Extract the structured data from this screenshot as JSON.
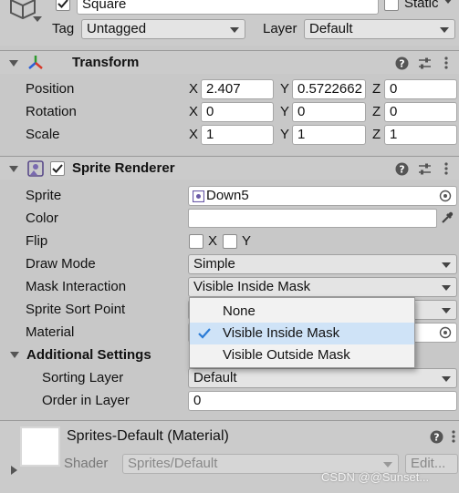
{
  "object": {
    "name": "Square",
    "active": true,
    "static_label": "Static",
    "static": false,
    "tag_label": "Tag",
    "tag_value": "Untagged",
    "layer_label": "Layer",
    "layer_value": "Default"
  },
  "transform": {
    "title": "Transform",
    "rows": [
      {
        "label": "Position",
        "x": "2.407",
        "y": "0.5722662",
        "z": "0"
      },
      {
        "label": "Rotation",
        "x": "0",
        "y": "0",
        "z": "0"
      },
      {
        "label": "Scale",
        "x": "1",
        "y": "1",
        "z": "1"
      }
    ],
    "axis_x": "X",
    "axis_y": "Y",
    "axis_z": "Z"
  },
  "sprite_renderer": {
    "title": "Sprite Renderer",
    "enabled": true,
    "sprite_label": "Sprite",
    "sprite_value": "Down5",
    "color_label": "Color",
    "color_value": "#ffffff",
    "flip_label": "Flip",
    "flip_x": "X",
    "flip_y": "Y",
    "draw_mode_label": "Draw Mode",
    "draw_mode_value": "Simple",
    "mask_label": "Mask Interaction",
    "mask_value": "Visible Inside Mask",
    "sort_point_label": "Sprite Sort Point",
    "material_label": "Material",
    "additional_settings": "Additional Settings",
    "sorting_layer_label": "Sorting Layer",
    "sorting_layer_value": "Default",
    "order_label": "Order in Layer",
    "order_value": "0"
  },
  "mask_menu": {
    "options": [
      "None",
      "Visible Inside Mask",
      "Visible Outside Mask"
    ],
    "selected": "Visible Inside Mask"
  },
  "material": {
    "title": "Sprites-Default (Material)",
    "shader_label": "Shader",
    "shader_value": "Sprites/Default",
    "edit_label": "Edit..."
  },
  "watermark": "CSDN @@Sunset..."
}
